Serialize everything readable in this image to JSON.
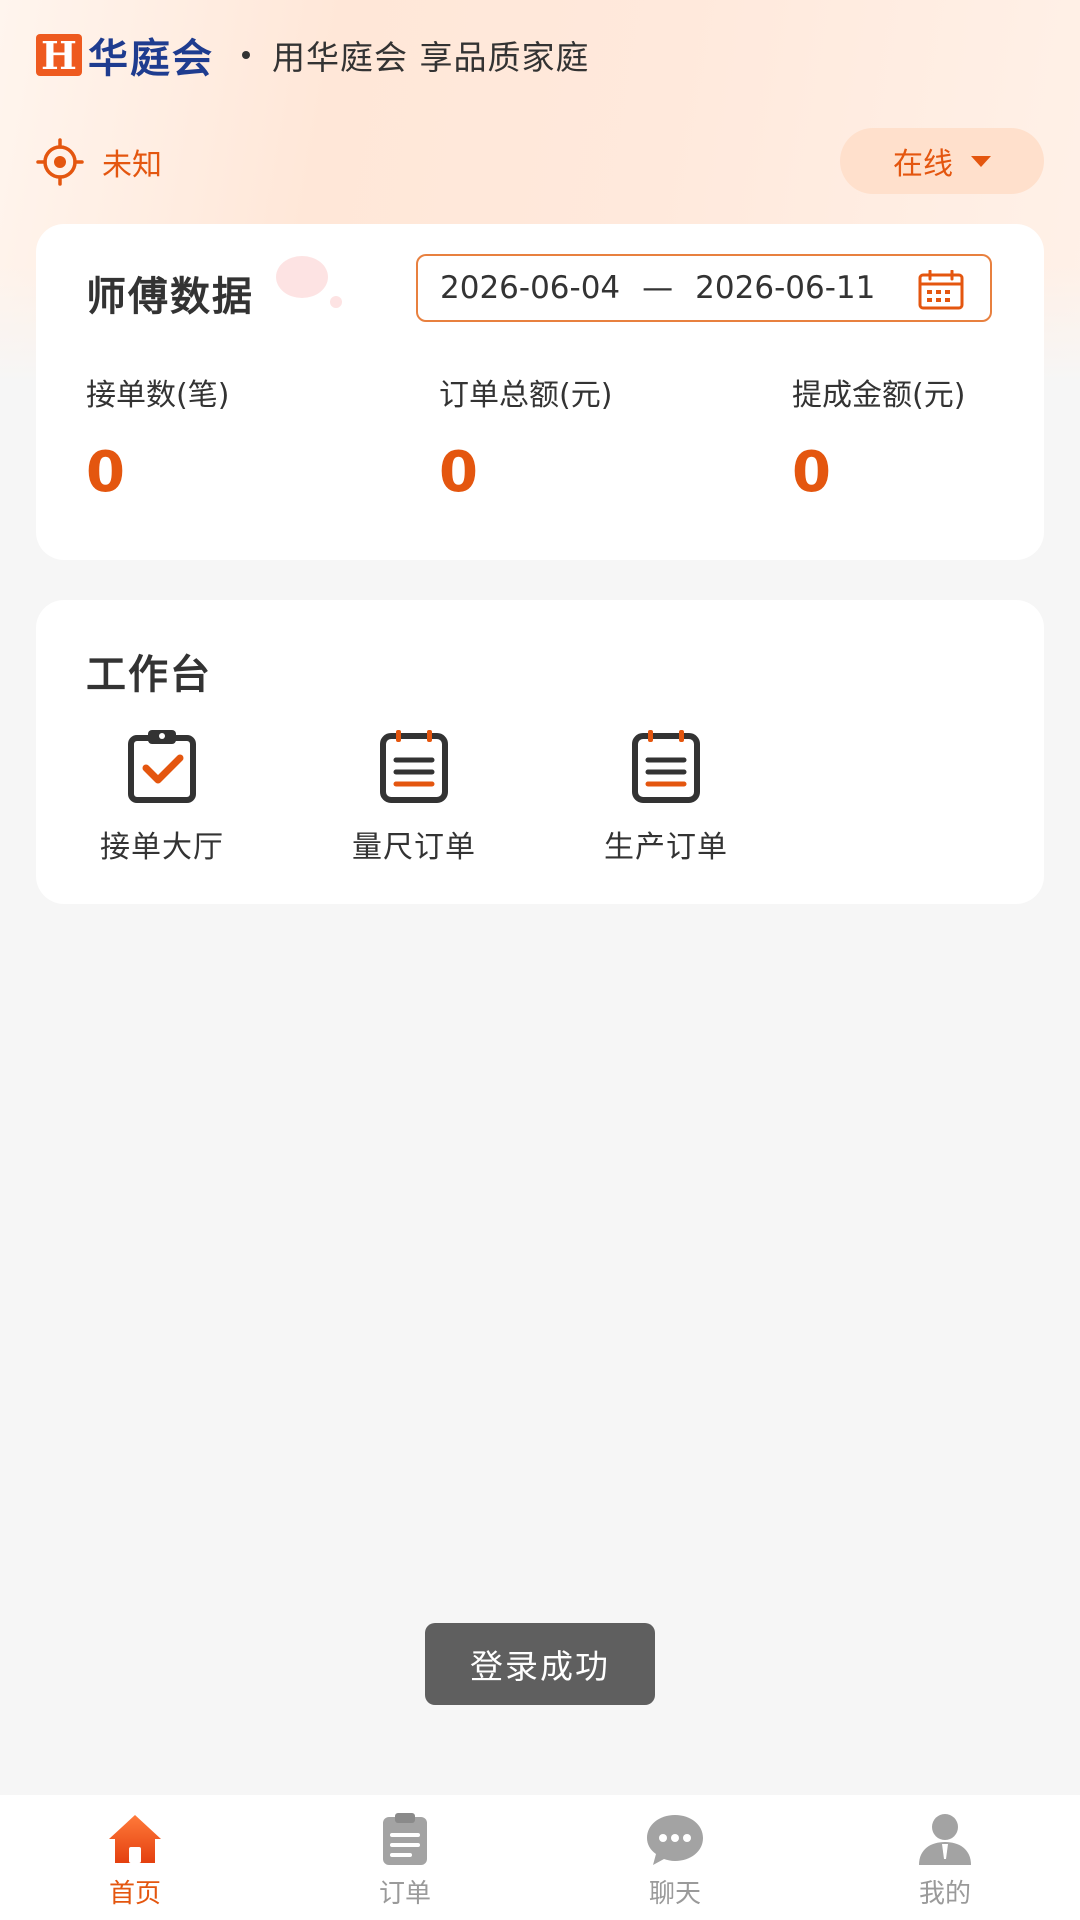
{
  "brand": {
    "logo_letter": "H",
    "name": "华庭会",
    "slogan": "用华庭会 享品质家庭"
  },
  "location": {
    "icon": "locate-icon",
    "text": "未知"
  },
  "status": {
    "label": "在线",
    "icon": "caret-down-icon"
  },
  "stats": {
    "title": "师傅数据",
    "date_start": "2026-06-04",
    "date_separator": "—",
    "date_end": "2026-06-11",
    "items": [
      {
        "label": "接单数(笔)",
        "value": "0"
      },
      {
        "label": "订单总额(元)",
        "value": "0"
      },
      {
        "label": "提成金额(元)",
        "value": "0"
      }
    ]
  },
  "workbench": {
    "title": "工作台",
    "items": [
      {
        "label": "接单大厅",
        "icon": "clipboard-check-icon"
      },
      {
        "label": "量尺订单",
        "icon": "clipboard-list-icon"
      },
      {
        "label": "生产订单",
        "icon": "clipboard-list-icon"
      }
    ]
  },
  "toast": {
    "text": "登录成功"
  },
  "tabbar": {
    "items": [
      {
        "label": "首页",
        "icon": "home-icon",
        "active": true
      },
      {
        "label": "订单",
        "icon": "order-list-icon",
        "active": false
      },
      {
        "label": "聊天",
        "icon": "chat-bubble-icon",
        "active": false
      },
      {
        "label": "我的",
        "icon": "user-icon",
        "active": false
      }
    ]
  },
  "colors": {
    "accent": "#e4560f",
    "brand_blue": "#1f3c8f",
    "inactive": "#9a9a9a"
  }
}
